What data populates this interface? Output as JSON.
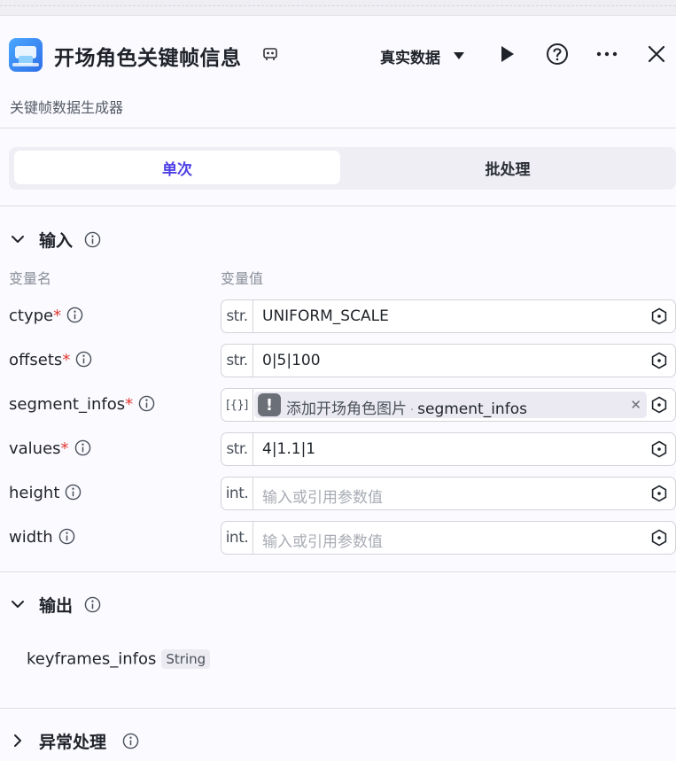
{
  "header": {
    "title": "开场角色关键帧信息",
    "subtitle": "关键帧数据生成器",
    "mode_label": "真实数据"
  },
  "tabs": [
    {
      "label": "单次",
      "active": true
    },
    {
      "label": "批处理",
      "active": false
    }
  ],
  "input_section": {
    "title": "输入",
    "col_name": "变量名",
    "col_value": "变量值",
    "params": [
      {
        "name": "ctype",
        "required": "*",
        "type": "str.",
        "value": "UNIFORM_SCALE",
        "placeholder": ""
      },
      {
        "name": "offsets",
        "required": "*",
        "type": "str.",
        "value": "0|5|100",
        "placeholder": ""
      },
      {
        "name": "segment_infos",
        "required": "*",
        "type": "[{}]",
        "ref_node": "添加开场角色图片",
        "ref_param": "segment_infos"
      },
      {
        "name": "values",
        "required": "*",
        "type": "str.",
        "value": "4|1.1|1",
        "placeholder": ""
      },
      {
        "name": "height",
        "required": "",
        "type": "int.",
        "value": "",
        "placeholder": "输入或引用参数值"
      },
      {
        "name": "width",
        "required": "",
        "type": "int.",
        "value": "",
        "placeholder": "输入或引用参数值"
      }
    ]
  },
  "output_section": {
    "title": "输出",
    "items": [
      {
        "name": "keyframes_infos",
        "type": "String"
      }
    ]
  },
  "error_section": {
    "title": "异常处理"
  },
  "colors": {
    "accent": "#4e40e5",
    "required": "#e2392f",
    "background": "#fbfaff"
  },
  "icons": [
    "workflow-app-icon",
    "copy-icon",
    "caret-down-icon",
    "play-icon",
    "help-icon",
    "more-icon",
    "close-icon",
    "chevron-down-icon",
    "chevron-right-icon",
    "info-icon",
    "reference-icon",
    "warning-icon"
  ]
}
